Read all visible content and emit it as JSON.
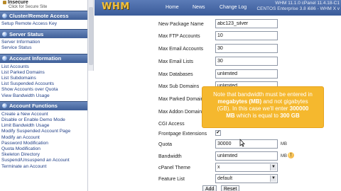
{
  "sidebar": {
    "top_item": "Insecure",
    "top_sub": "Click for Secure Site",
    "sections": [
      {
        "title": "Cluster/Remote Access",
        "links": [
          "Setup Remote Access Key"
        ]
      },
      {
        "title": "Server Status",
        "links": [
          "Server Information",
          "Service Status"
        ]
      },
      {
        "title": "Account Information",
        "links": [
          "List Accounts",
          "List Parked Domains",
          "List Subdomains",
          "List Suspended Accounts",
          "Show Accounts over Quota",
          "View Bandwidth Usage"
        ]
      },
      {
        "title": "Account Functions",
        "links": [
          "Create a New Account",
          "Disable or Enable Demo Mode",
          "Limit Bandwidth Usage",
          "Modify Suspended Account Page",
          "Modify an Account",
          "Password Modification",
          "Quota Modification",
          "Skeleton Directory",
          "Suspend/Unsuspend an Account",
          "Terminate an Account"
        ]
      }
    ]
  },
  "header": {
    "logo": "WHM",
    "nav": [
      "Home",
      "News",
      "Change Log"
    ],
    "info_line1": "WHM 11.1.0 cPanel 11.4.18-C1",
    "info_line2": "CENTOS Enterprise 3.8 i686 - WHM X v"
  },
  "form": {
    "fields": [
      {
        "label": "New Package Name",
        "value": "abc123_silver"
      },
      {
        "label": "Max FTP Accounts",
        "value": "10"
      },
      {
        "label": "Max Email Accounts",
        "value": "30"
      },
      {
        "label": "Max Email Lists",
        "value": "30"
      },
      {
        "label": "Max Databases",
        "value": "unlimited"
      },
      {
        "label": "Max Sub Domains",
        "value": "unlimited"
      },
      {
        "label": "Max Parked Domains",
        "value": ""
      },
      {
        "label": "Max Addon Domains",
        "value": ""
      },
      {
        "label": "CGI Access",
        "value": ""
      },
      {
        "label": "Frontpage Extensions",
        "value": ""
      },
      {
        "label": "Quota",
        "value": "30000",
        "unit": "MB"
      },
      {
        "label": "Bandwidth",
        "value": "unlimited",
        "unit": "MB"
      },
      {
        "label": "cPanel Theme",
        "value": "x"
      },
      {
        "label": "Feature List",
        "value": "default"
      }
    ],
    "checkbox_mark": "✔",
    "add_label": "Add",
    "reset_label": "Reset",
    "warn_icon": "!"
  },
  "callout": {
    "line_a": "Note that bandwidth must be entered in",
    "line_b_bold": "megabytes (MB)",
    "line_b_rest": " and not gigabytes",
    "line_c_pre": "(GB). In this case we'll enter ",
    "line_c_bold": "300000",
    "line_d_bold": "MB",
    "line_d_mid": " which is equal to ",
    "line_d_end": "300 GB"
  },
  "colors": {
    "header": "#4a6aa8",
    "callout": "#f5b82e",
    "link": "#1f3e86",
    "logo": "#f0c040"
  }
}
